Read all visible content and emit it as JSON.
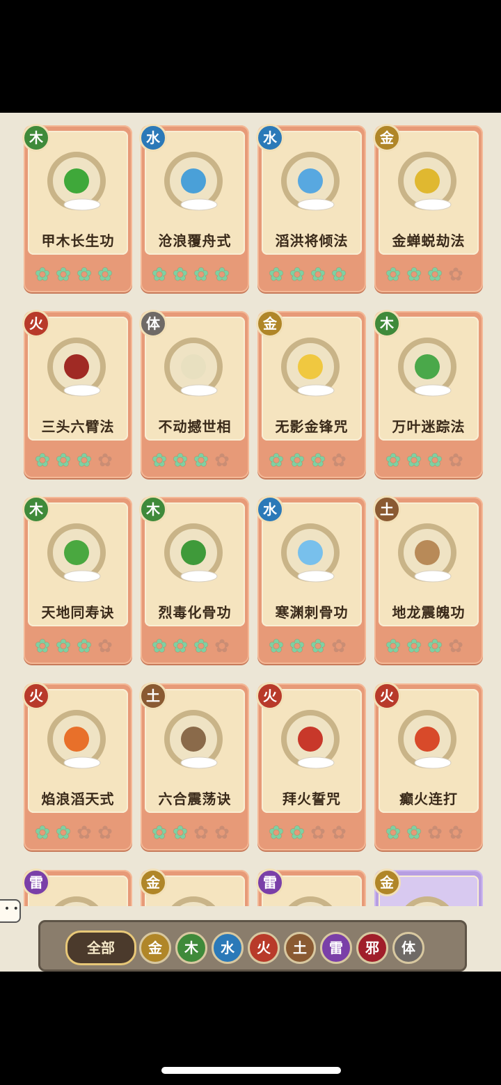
{
  "elements": {
    "木": {
      "label": "木",
      "color": "#3f8a3a"
    },
    "水": {
      "label": "水",
      "color": "#2b79b8"
    },
    "金": {
      "label": "金",
      "color": "#b08628"
    },
    "火": {
      "label": "火",
      "color": "#b83a2a"
    },
    "体": {
      "label": "体",
      "color": "#6f6a66"
    },
    "土": {
      "label": "土",
      "color": "#8a5a32"
    },
    "雷": {
      "label": "雷",
      "color": "#7a3fa8"
    },
    "邪": {
      "label": "邪",
      "color": "#a01e2a"
    }
  },
  "cards": [
    {
      "name": "甲木长生功",
      "element": "木",
      "stars": 4,
      "icon": "tree-emblem"
    },
    {
      "name": "沧浪覆舟式",
      "element": "水",
      "stars": 4,
      "icon": "wave-emblem"
    },
    {
      "name": "滔洪将倾法",
      "element": "水",
      "stars": 4,
      "icon": "flood-emblem"
    },
    {
      "name": "金蝉蜕劫法",
      "element": "金",
      "stars": 3,
      "icon": "golden-cicada-emblem"
    },
    {
      "name": "三头六臂法",
      "element": "火",
      "stars": 3,
      "icon": "three-heads-emblem"
    },
    {
      "name": "不动撼世相",
      "element": "体",
      "stars": 3,
      "icon": "skull-emblem"
    },
    {
      "name": "无影金锋咒",
      "element": "金",
      "stars": 3,
      "icon": "gold-blade-emblem"
    },
    {
      "name": "万叶迷踪法",
      "element": "木",
      "stars": 3,
      "icon": "leaves-emblem"
    },
    {
      "name": "天地同寿诀",
      "element": "木",
      "stars": 3,
      "icon": "green-spirit-emblem"
    },
    {
      "name": "烈毒化骨功",
      "element": "木",
      "stars": 3,
      "icon": "poison-emblem"
    },
    {
      "name": "寒渊刺骨功",
      "element": "水",
      "stars": 3,
      "icon": "ice-crystal-emblem"
    },
    {
      "name": "地龙震魄功",
      "element": "土",
      "stars": 3,
      "icon": "earth-dragon-emblem"
    },
    {
      "name": "焰浪滔天式",
      "element": "火",
      "stars": 2,
      "icon": "flame-wave-emblem"
    },
    {
      "name": "六合震荡诀",
      "element": "土",
      "stars": 2,
      "icon": "mound-emblem"
    },
    {
      "name": "拜火誓咒",
      "element": "火",
      "stars": 2,
      "icon": "fire-figure-emblem"
    },
    {
      "name": "癫火连打",
      "element": "火",
      "stars": 2,
      "icon": "fire-orb-emblem"
    },
    {
      "name": "",
      "element": "雷",
      "stars": 0,
      "icon": "thunder-emblem"
    },
    {
      "name": "",
      "element": "金",
      "stars": 0,
      "icon": "gold-emblem"
    },
    {
      "name": "",
      "element": "雷",
      "stars": 0,
      "icon": "thunder-emblem"
    },
    {
      "name": "",
      "element": "金",
      "stars": 0,
      "icon": "gold-emblem",
      "rarity": "purple"
    }
  ],
  "filter": {
    "all_label": "全部",
    "buttons": [
      "金",
      "木",
      "水",
      "火",
      "土",
      "雷",
      "邪",
      "体"
    ]
  },
  "chat_icon": "speech-bubble-icon"
}
